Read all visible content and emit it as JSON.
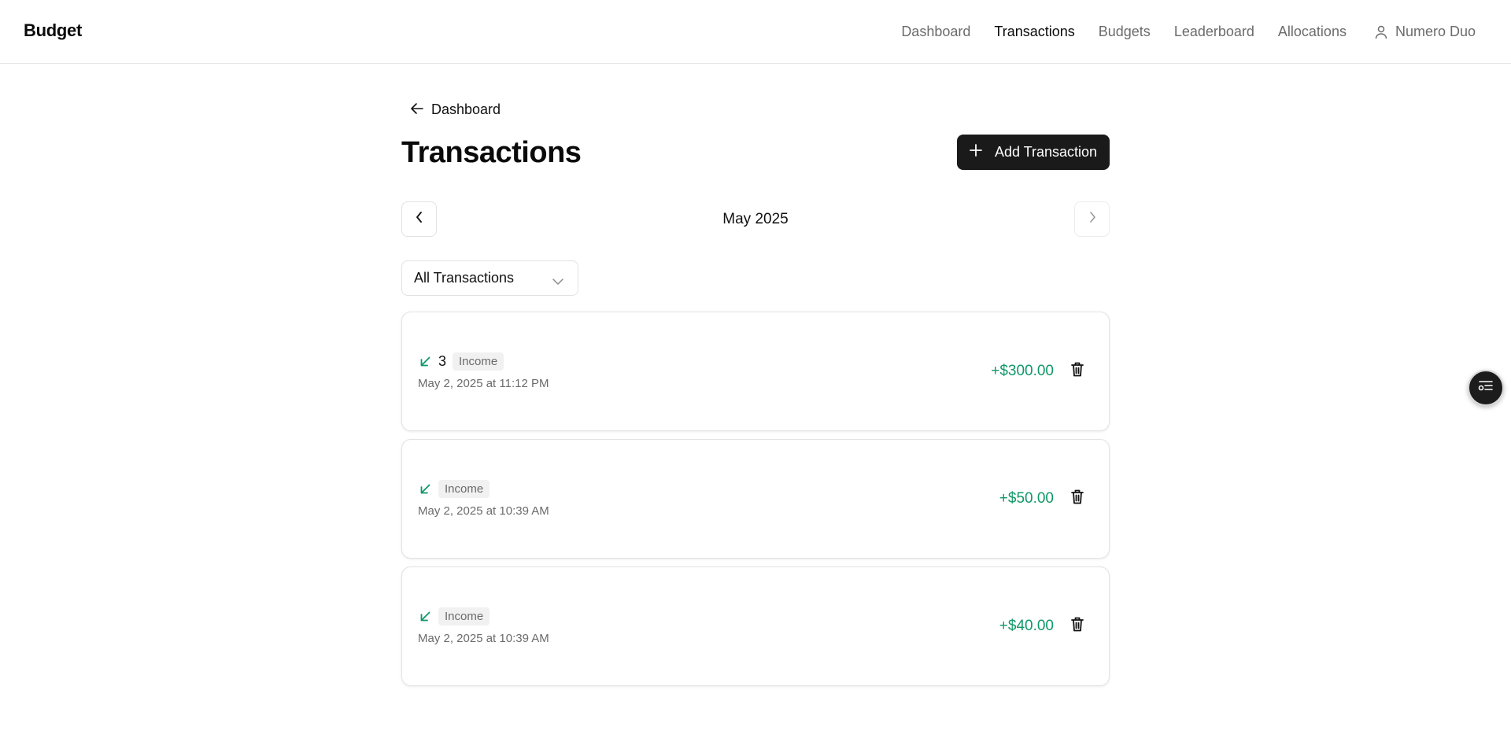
{
  "app": {
    "brand": "Budget"
  },
  "nav": {
    "items": [
      {
        "label": "Dashboard",
        "active": false
      },
      {
        "label": "Transactions",
        "active": true
      },
      {
        "label": "Budgets",
        "active": false
      },
      {
        "label": "Leaderboard",
        "active": false
      },
      {
        "label": "Allocations",
        "active": false
      }
    ],
    "user": {
      "name": "Numero Duo",
      "icon": "user-icon"
    }
  },
  "page": {
    "back_label": "Dashboard",
    "title": "Transactions",
    "add_button_label": "Add Transaction"
  },
  "month": {
    "label": "May 2025"
  },
  "filter": {
    "selected": "All Transactions"
  },
  "transactions": [
    {
      "description": "3",
      "category": "Income",
      "date": "May 2, 2025 at 11:12 PM",
      "amount": "+$300.00"
    },
    {
      "description": "",
      "category": "Income",
      "date": "May 2, 2025 at 10:39 AM",
      "amount": "+$50.00"
    },
    {
      "description": "",
      "category": "Income",
      "date": "May 2, 2025 at 10:39 AM",
      "amount": "+$40.00"
    }
  ],
  "colors": {
    "income": "#109868",
    "primary_button": "#1a1a1a",
    "muted_text": "#6b6b6b"
  }
}
